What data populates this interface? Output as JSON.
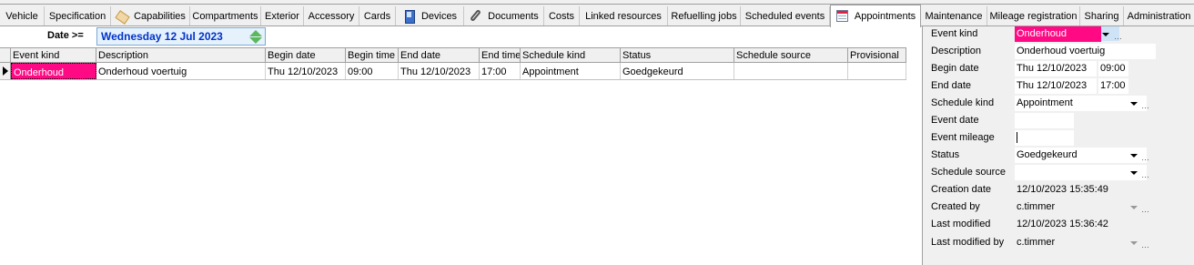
{
  "tabs": [
    {
      "label": "Vehicle",
      "icon": null
    },
    {
      "label": "Specification",
      "icon": null
    },
    {
      "label": "Capabilities",
      "icon": "tag-icon"
    },
    {
      "label": "Compartments",
      "icon": null
    },
    {
      "label": "Exterior",
      "icon": null
    },
    {
      "label": "Accessory",
      "icon": null
    },
    {
      "label": "Cards",
      "icon": null
    },
    {
      "label": "Devices",
      "icon": "device-icon"
    },
    {
      "label": "Documents",
      "icon": "paperclip-icon"
    },
    {
      "label": "Costs",
      "icon": null
    },
    {
      "label": "Linked resources",
      "icon": null
    },
    {
      "label": "Refuelling jobs",
      "icon": null
    },
    {
      "label": "Scheduled events",
      "icon": null
    },
    {
      "label": "Appointments",
      "icon": "calendar-icon",
      "active": true
    },
    {
      "label": "Maintenance",
      "icon": null
    },
    {
      "label": "Mileage registration",
      "icon": null
    },
    {
      "label": "Sharing",
      "icon": null
    },
    {
      "label": "Administration",
      "icon": null
    }
  ],
  "filter": {
    "label": "Date >=",
    "value": "Wednesday 12 Jul 2023"
  },
  "grid": {
    "columns": [
      "Event kind",
      "Description",
      "Begin date",
      "Begin time",
      "End date",
      "End time",
      "Schedule kind",
      "Status",
      "Schedule source",
      "Provisional"
    ],
    "rows": [
      [
        "Onderhoud",
        "Onderhoud voertuig",
        "Thu 12/10/2023",
        "09:00",
        "Thu 12/10/2023",
        "17:00",
        "Appointment",
        "Goedgekeurd",
        "",
        ""
      ]
    ]
  },
  "details": {
    "event_kind": {
      "label": "Event kind",
      "value": "Onderhoud"
    },
    "description": {
      "label": "Description",
      "value": "Onderhoud voertuig"
    },
    "begin_date": {
      "label": "Begin date",
      "date": "Thu 12/10/2023",
      "time": "09:00"
    },
    "end_date": {
      "label": "End date",
      "date": "Thu 12/10/2023",
      "time": "17:00"
    },
    "schedule_kind": {
      "label": "Schedule kind",
      "value": "Appointment"
    },
    "event_date": {
      "label": "Event date",
      "value": ""
    },
    "event_mileage": {
      "label": "Event mileage",
      "value": ""
    },
    "status": {
      "label": "Status",
      "value": "Goedgekeurd"
    },
    "schedule_source": {
      "label": "Schedule source",
      "value": ""
    },
    "creation_date": {
      "label": "Creation date",
      "value": "12/10/2023 15:35:49"
    },
    "created_by": {
      "label": "Created by",
      "value": "c.timmer"
    },
    "last_modified": {
      "label": "Last modified",
      "value": "12/10/2023 15:36:42"
    },
    "last_modified_by": {
      "label": "Last modified by",
      "value": "c.timmer"
    }
  },
  "colors": {
    "event_kind_highlight": "#ff0a84",
    "filter_text": "#0033cc",
    "filter_background": "#e6f2fb"
  }
}
